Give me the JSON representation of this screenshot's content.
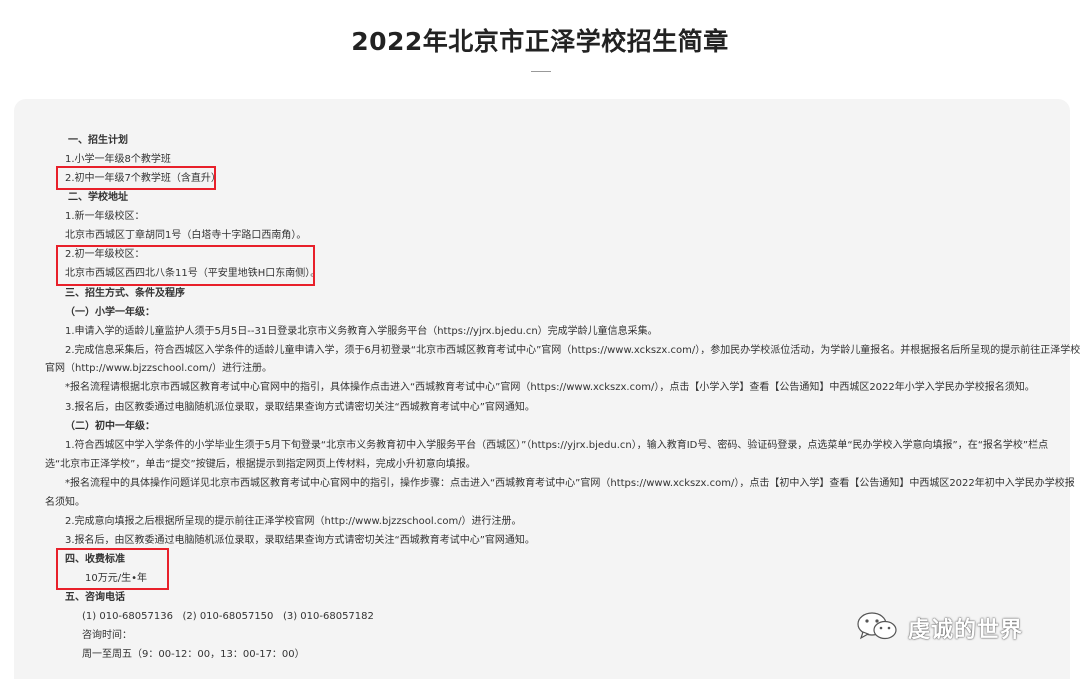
{
  "title": "2022年北京市正泽学校招生简章",
  "sections": {
    "s1_head": "一、招生计划",
    "s1_item1": "1.小学一年级8个教学班",
    "s1_item2": "2.初中一年级7个教学班（含直升）",
    "s2_head": "二、学校地址",
    "s2_item1": "1.新一年级校区：",
    "s2_item1_addr": "北京市西城区丁章胡同1号（白塔寺十字路口西南角）。",
    "s2_item2": "2.初一年级校区：",
    "s2_item2_addr": "北京市西城区西四北八条11号（平安里地铁H口东南侧）。",
    "s3_head": "三、招生方式、条件及程序",
    "s3_sub1": "（一）小学一年级：",
    "p1": "1.申请入学的适龄儿童监护人须于5月5日--31日登录北京市义务教育入学服务平台（https://yjrx.bjedu.cn）完成学龄儿童信息采集。",
    "p2a": "2.完成信息采集后，符合西城区入学条件的适龄儿童申请入学，须于6月初登录“北京市西城区教育考试中心”官网（https://www.xckszx.com/），参加民办学校派位活动，为学龄儿童报名。并根据报名后所呈现的提示前往正泽学校",
    "p2b": "官网（http://www.bjzzschool.com/）进行注册。",
    "p3": "*报名流程请根据北京市西城区教育考试中心官网中的指引，具体操作点击进入“西城教育考试中心”官网（https://www.xckszx.com/），点击【小学入学】查看【公告通知】中西城区2022年小学入学民办学校报名须知。",
    "p4": "3.报名后，由区教委通过电脑随机派位录取，录取结果查询方式请密切关注“西城教育考试中心”官网通知。",
    "s3_sub2": "（二）初中一年级：",
    "q1a": "1.符合西城区中学入学条件的小学毕业生须于5月下旬登录“北京市义务教育初中入学服务平台（西城区）”（https://yjrx.bjedu.cn），输入教育ID号、密码、验证码登录，点选菜单“民办学校入学意向填报”，在“报名学校”栏点",
    "q1b": "选“北京市正泽学校”，单击“提交”按键后，根据提示到指定网页上传材料，完成小升初意向填报。",
    "q2a": "*报名流程中的具体操作问题详见北京市西城区教育考试中心官网中的指引，操作步骤：点击进入“西城教育考试中心”官网（https://www.xckszx.com/），点击【初中入学】查看【公告通知】中西城区2022年初中入学民办学校报",
    "q2b": "名须知。",
    "q3": "2.完成意向填报之后根据所呈现的提示前往正泽学校官网（http://www.bjzzschool.com/）进行注册。",
    "q4": "3.报名后，由区教委通过电脑随机派位录取，录取结果查询方式请密切关注“西城教育考试中心”官网通知。",
    "s4_head": "四、收费标准",
    "s4_fee": "10万元/生•年",
    "s5_head": "五、咨询电话",
    "s5_phones": "(1) 010-68057136   (2) 010-68057150   (3) 010-68057182",
    "s5_time_label": "咨询时间：",
    "s5_time": "周一至周五（9：00-12：00，13：00-17：00）"
  },
  "watermark": "虔诚的世界",
  "colors": {
    "highlight": "#e8202a",
    "card_bg": "#f4f4f4"
  }
}
